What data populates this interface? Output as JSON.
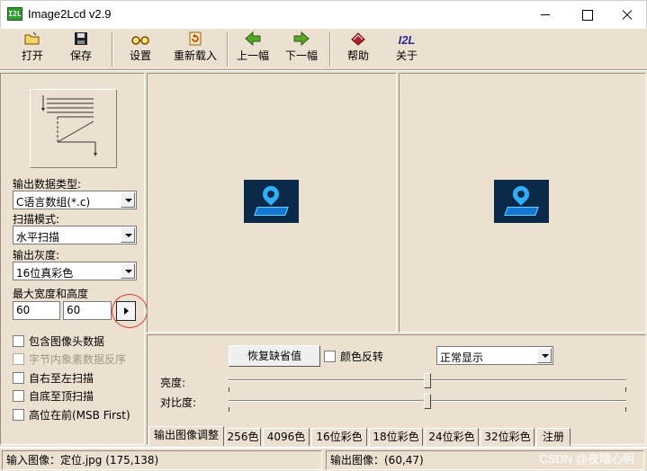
{
  "window": {
    "title": "Image2Lcd v2.9",
    "icon_text": "I2L"
  },
  "toolbar": {
    "items": [
      {
        "label": "打开",
        "icon": "open-folder-icon"
      },
      {
        "label": "保存",
        "icon": "floppy-disk-icon"
      },
      {
        "label": "设置",
        "icon": "glasses-icon"
      },
      {
        "label": "重新载入",
        "icon": "reload-icon"
      },
      {
        "label": "上一幅",
        "icon": "arrow-left-icon"
      },
      {
        "label": "下一幅",
        "icon": "arrow-right-icon"
      },
      {
        "label": "帮助",
        "icon": "help-book-icon"
      },
      {
        "label": "关于",
        "icon": "i2l-logo-icon"
      }
    ],
    "about_icon_text": "I2L"
  },
  "left": {
    "output_type_label": "输出数据类型:",
    "output_type_value": "C语言数组(*.c)",
    "scan_mode_label": "扫描模式:",
    "scan_mode_value": "水平扫描",
    "gray_label": "输出灰度:",
    "gray_value": "16位真彩色",
    "size_label": "最大宽度和高度",
    "width_value": "60",
    "height_value": "60",
    "checkboxes": [
      {
        "label": "包含图像头数据",
        "enabled": true
      },
      {
        "label": "字节内象素数据反序",
        "enabled": false
      },
      {
        "label": "自右至左扫描",
        "enabled": true
      },
      {
        "label": "自底至顶扫描",
        "enabled": true
      },
      {
        "label": "高位在前(MSB First)",
        "enabled": true
      }
    ]
  },
  "bottom": {
    "restore_label": "恢复缺省值",
    "invert_label": "颜色反转",
    "display_mode_value": "正常显示",
    "brightness_label": "亮度:",
    "contrast_label": "对比度:",
    "brightness_level": 0.5,
    "contrast_level": 0.5,
    "tabs": [
      "输出图像调整",
      "256色",
      "4096色",
      "16位彩色",
      "18位彩色",
      "24位彩色",
      "32位彩色",
      "注册"
    ]
  },
  "status": {
    "input": "输入图像：定位.jpg (175,138)",
    "output": "输出图像：(60,47)"
  },
  "watermark": "CSDN @夜暗心明",
  "colors": {
    "panel_bg": "#ece0d0",
    "annotation_circle": "#e03030"
  }
}
